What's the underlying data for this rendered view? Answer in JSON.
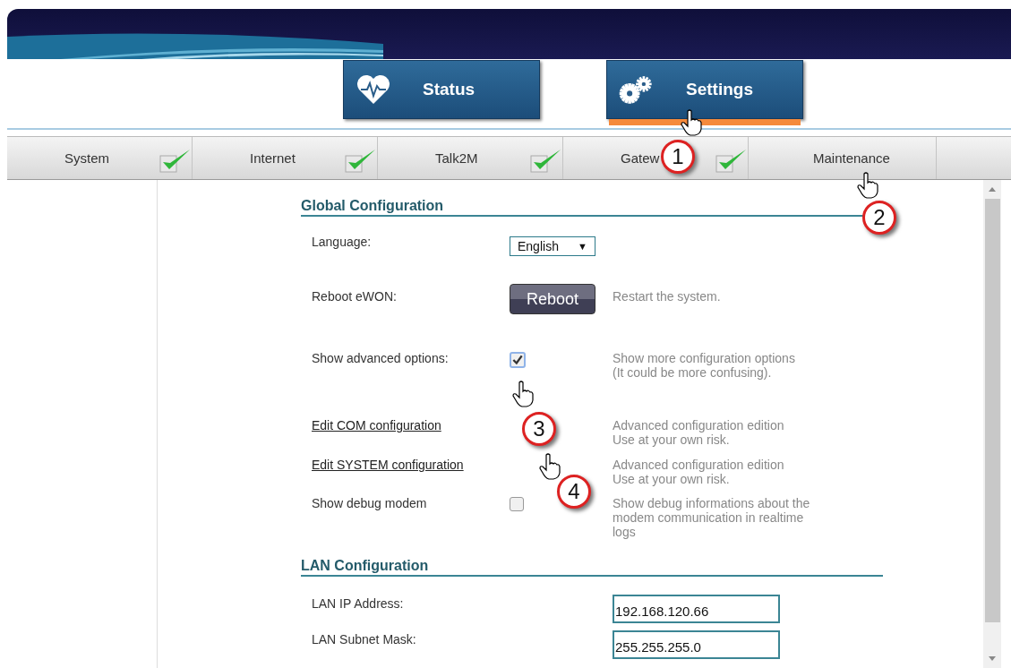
{
  "main_tabs": [
    {
      "label": "Status",
      "kind": "health",
      "selected": false
    },
    {
      "label": "Settings",
      "kind": "setup",
      "selected": true
    }
  ],
  "sub_tabs": [
    {
      "label": "System",
      "checked": true
    },
    {
      "label": "Internet",
      "checked": true
    },
    {
      "label": "Talk2M",
      "checked": true
    },
    {
      "label": "Gatew",
      "checked": true
    },
    {
      "label": "Maintenance",
      "checked": false
    }
  ],
  "sections": [
    {
      "title": "Global Configuration",
      "rows": [
        {
          "kind": "select",
          "label": "Language:",
          "value": "English",
          "caret": "▼"
        },
        {
          "kind": "button",
          "label": "Reboot eWON:",
          "button": "Reboot",
          "description": "Restart the system."
        },
        {
          "kind": "checkbox",
          "label": "Show advanced options:",
          "checked": true,
          "description": "Show more configuration options\n(It could be more confusing)."
        },
        {
          "kind": "link",
          "label": "Edit COM configuration",
          "description": "Advanced configuration edition\nUse at your own risk."
        },
        {
          "kind": "link",
          "label": "Edit SYSTEM configuration",
          "description": "Advanced configuration edition\nUse at your own risk."
        },
        {
          "kind": "checkbox",
          "label": "Show debug modem",
          "checked": false,
          "description": "Show debug informations about the\nmodem communication in realtime\nlogs"
        }
      ]
    },
    {
      "title": "LAN Configuration",
      "rows": [
        {
          "kind": "input",
          "label": "LAN IP Address:",
          "value": "192.168.120.66"
        },
        {
          "kind": "input",
          "label": "LAN Subnet Mask:",
          "value": "255.255.255.0"
        }
      ]
    }
  ],
  "callouts": [
    {
      "number": "1"
    },
    {
      "number": "2"
    },
    {
      "number": "3"
    },
    {
      "number": "4"
    }
  ]
}
